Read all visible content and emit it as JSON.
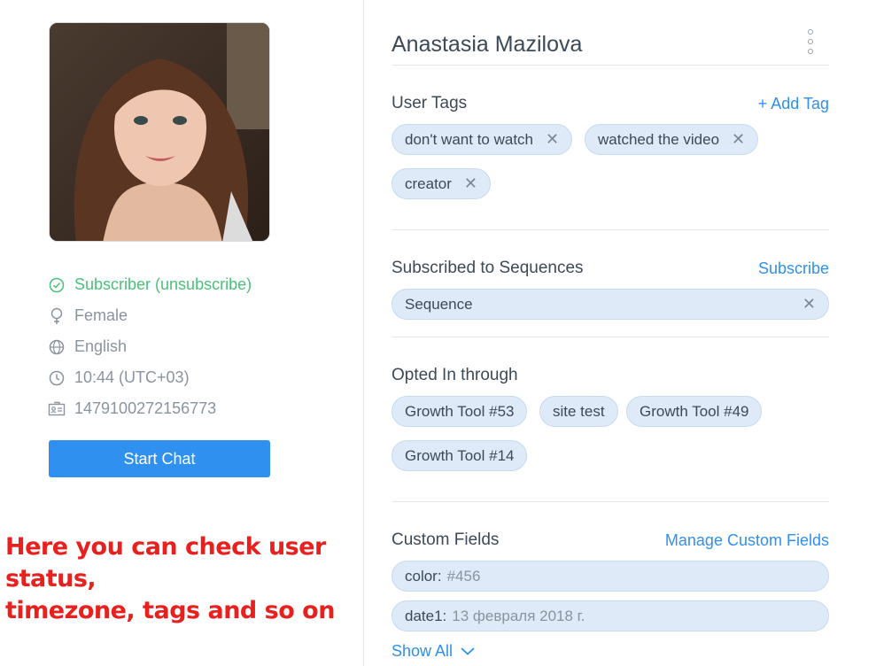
{
  "profile": {
    "status": "Subscriber (unsubscribe)",
    "gender": "Female",
    "language": "English",
    "time": "10:44 (UTC+03)",
    "id": "1479100272156773",
    "start_chat_label": "Start Chat"
  },
  "annotation": {
    "line1": "Here you can check user status,",
    "line2": "timezone, tags and so on"
  },
  "details": {
    "name": "Anastasia Mazilova",
    "user_tags": {
      "title": "User Tags",
      "action": "+ Add Tag",
      "tags": [
        "don't want to watch",
        "watched the video",
        "creator"
      ]
    },
    "sequences": {
      "title": "Subscribed to Sequences",
      "action": "Subscribe",
      "items": [
        "Sequence"
      ]
    },
    "opted_in": {
      "title": "Opted In through",
      "items": [
        "Growth Tool #53",
        "site test",
        "Growth Tool #49",
        "Growth Tool #14"
      ]
    },
    "custom_fields": {
      "title": "Custom Fields",
      "action": "Manage Custom Fields",
      "fields": [
        {
          "key": "color:",
          "value": "#456"
        },
        {
          "key": "date1:",
          "value": "13 февраля 2018 г."
        }
      ],
      "show_all": "Show All"
    }
  },
  "colors": {
    "accent": "#3090f0",
    "success": "#4cc07a",
    "tag_bg": "#deeaf8",
    "annotation": "#e8211f"
  },
  "icons": [
    "check-circle-icon",
    "female-icon",
    "globe-icon",
    "clock-icon",
    "id-card-icon",
    "kebab-menu-icon",
    "close-icon",
    "chevron-down-icon"
  ]
}
